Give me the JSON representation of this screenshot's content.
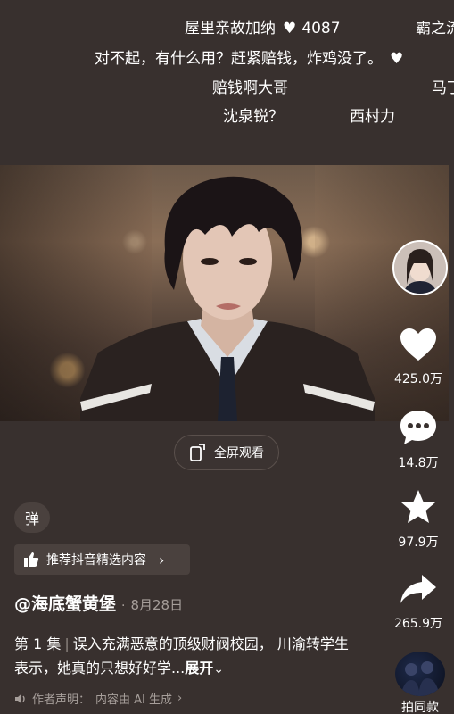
{
  "danmu": {
    "line1_left": "屋里亲故加纳",
    "line1_likes": "4087",
    "line1_right": "霸之流",
    "line2": "对不起，有什么用？赶紧赔钱，炸鸡没了。",
    "line3_left": "赔钱啊大哥",
    "line3_right": "马丁",
    "line4_left": "沈泉锐？",
    "line4_right": "西村力"
  },
  "player": {
    "fullscreen_label": "全屏观看"
  },
  "sidebar": {
    "likes": "425.0万",
    "comments": "14.8万",
    "favorites": "97.9万",
    "shares": "265.9万",
    "same_style": "拍同款"
  },
  "bullet_toggle": "弹",
  "recommend_label": "推荐抖音精选内容",
  "author": {
    "name": "@海底蟹黄堡",
    "separator": "·",
    "date": "8月28日"
  },
  "description": {
    "episode": "第 1 集",
    "text": "误入充满恶意的顶级财阀校园， 川渝转学生表示，她真的只想好好学...",
    "expand": "展开"
  },
  "statement": {
    "label": "作者声明：",
    "value": "内容由 AI 生成"
  },
  "colors": {
    "background": "#38302e",
    "muted": "#a69e9a"
  }
}
